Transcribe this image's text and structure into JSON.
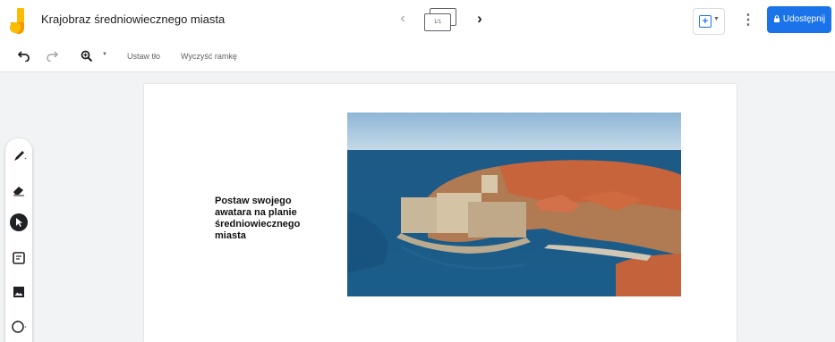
{
  "header": {
    "title": "Krajobraz średniowiecznego miasta",
    "frame_indicator": "1/1",
    "share_label": "Udostępnij",
    "accent_color": "#1a73e8"
  },
  "toolbar": {
    "undo_icon": "undo-icon",
    "redo_icon": "redo-icon",
    "zoom_icon": "zoom-icon",
    "set_background_label": "Ustaw tło",
    "clear_frame_label": "Wyczyść ramkę"
  },
  "sidebar": {
    "tools": [
      "pen-icon",
      "eraser-icon",
      "select-icon",
      "sticky-note-icon",
      "image-icon",
      "circle-icon"
    ]
  },
  "canvas": {
    "text": "Postaw swojego awatara na planie średniowiecznego miasta"
  }
}
